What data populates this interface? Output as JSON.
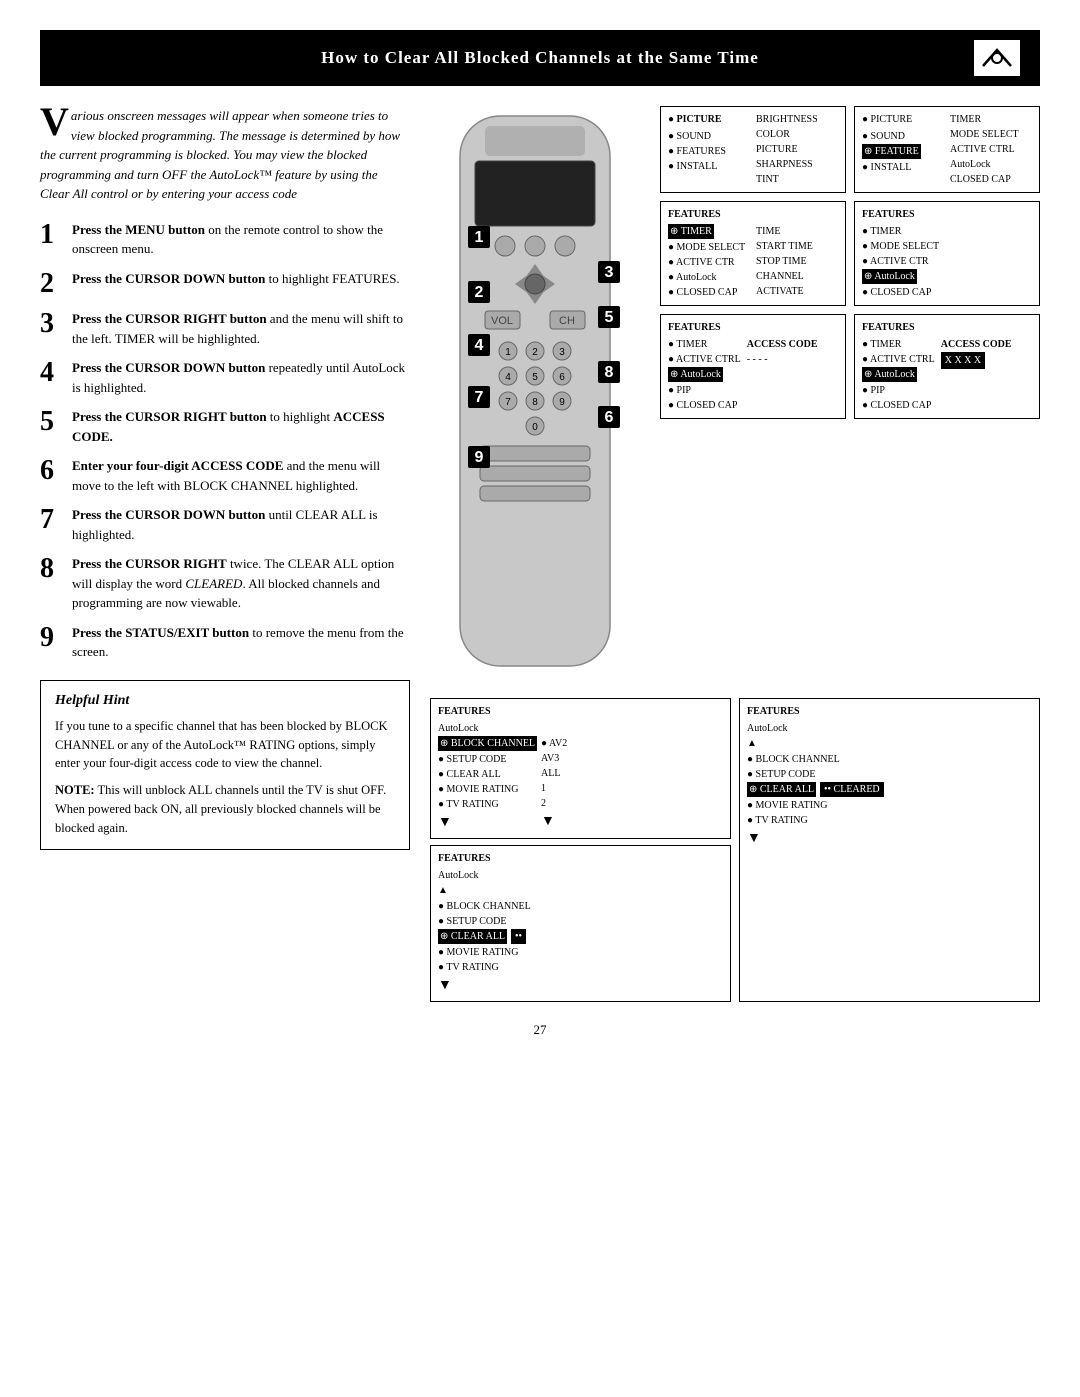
{
  "header": {
    "title": "How to Clear All Blocked Channels at the Same Time"
  },
  "intro": {
    "drop_cap": "V",
    "text": "arious onscreen messages will appear when someone tries to view blocked programming. The message is determined by how the current programming is blocked. You may view the blocked programming and turn OFF the AutoLock™ feature by using the Clear All control or by entering your access code"
  },
  "steps": [
    {
      "number": "1",
      "bold": "Press the MENU button",
      "text": " on the remote control to show the onscreen menu."
    },
    {
      "number": "2",
      "bold": "Press the CURSOR DOWN button",
      "text": " to highlight FEATURES."
    },
    {
      "number": "3",
      "bold": "Press the CURSOR RIGHT button",
      "text": " and the menu will shift to the left. TIMER will be highlighted."
    },
    {
      "number": "4",
      "bold": "Press the CURSOR DOWN button",
      "text": " repeatedly until AutoLock is highlighted."
    },
    {
      "number": "5",
      "bold": "Press the CURSOR RIGHT button",
      "text": " to highlight ACCESS CODE."
    },
    {
      "number": "6",
      "bold": "Enter your four-digit ACCESS CODE",
      "text": " and the menu will move to the left with BLOCK CHANNEL highlighted."
    },
    {
      "number": "7",
      "bold": "Press the CURSOR DOWN button",
      "text": " until CLEAR ALL is highlighted."
    },
    {
      "number": "8",
      "bold": "Press the CURSOR RIGHT",
      "text": " twice. The CLEAR ALL option will display the word CLEARED. All blocked channels and programming are now viewable."
    },
    {
      "number": "9",
      "bold": "Press the STATUS/EXIT button",
      "text": " to remove the menu from the screen."
    }
  ],
  "helpful_hint": {
    "title": "Helpful Hint",
    "paragraphs": [
      "If you tune to a specific channel that has been blocked by BLOCK CHANNEL or any of the AutoLock™ RATING options, simply enter your four-digit access code to view the channel.",
      "NOTE: This will unblock ALL channels until the TV is shut OFF. When powered back ON, all previously blocked channels will be blocked again."
    ]
  },
  "panels": {
    "panel1_title": "PICTURE",
    "panel1_items_left": [
      "SOUND",
      "FEATURES",
      "INSTALL"
    ],
    "panel1_items_right": [
      "BRIGHTNESS",
      "COLOR",
      "PICTURE",
      "SHARPNESS",
      "TINT"
    ],
    "panel2_title": "PICTURE",
    "panel2_items": [
      "SOUND",
      "FEATURE",
      "INSTALL"
    ],
    "panel2_right": [
      "TIMER",
      "MODE SELECT",
      "ACTIVE CTRL",
      "AutoLock",
      "CLOSED CAP"
    ],
    "panel3_title": "FEATURES",
    "panel3_highlighted": "TIMER",
    "panel3_items": [
      "MODE SELECT",
      "ACTIVE CTR",
      "AutoLock",
      "CLOSED CAP"
    ],
    "panel3_right": [
      "TIME",
      "START TIME",
      "STOP TIME",
      "CHANNEL",
      "ACTIVATE"
    ],
    "panel4_title": "FEATURES",
    "panel4_items": [
      "TIMER",
      "MODE SELECT",
      "ACTIVE CTR"
    ],
    "panel4_highlighted": "AutoLock",
    "panel4_items2": [
      "CLOSED CAP"
    ],
    "panel5_title": "FEATURES",
    "panel5_items": [
      "TIMER",
      "ACTIVE CTRL"
    ],
    "panel5_highlighted_autolock": "AutoLock",
    "panel5_items2": [
      "PIP",
      "CLOSED CAP"
    ],
    "panel5_right_label": "ACCESS CODE",
    "panel5_right_val": "- - - -",
    "panel6_title": "FEATURES",
    "panel6_items": [
      "TIMER",
      "ACTIVE CTRL"
    ],
    "panel6_highlighted_autolock": "AutoLock",
    "panel6_items2": [
      "PIP",
      "CLOSED CAP"
    ],
    "panel6_right_label": "ACCESS CODE",
    "panel6_access_box": "X X X X",
    "panel7_title": "FEATURES",
    "panel7_autolock": "AutoLock",
    "panel7_highlighted": "BLOCK CHANNEL",
    "panel7_items": [
      "SETUP CODE",
      "CLEAR ALL",
      "MOVIE RATING",
      "TV RATING"
    ],
    "panel7_right": [
      "AV2",
      "AV3",
      "ALL",
      "1",
      "2"
    ],
    "panel8_title": "FEATURES",
    "panel8_autolock": "AutoLock",
    "panel8_items": [
      "BLOCK CHANNEL",
      "SETUP CODE"
    ],
    "panel8_highlighted": "CLEAR ALL",
    "panel8_items2": [
      "MOVIE RATING",
      "TV RATING"
    ],
    "panel8_right_box": "••",
    "panel9_title": "FEATURES",
    "panel9_autolock": "AutoLock",
    "panel9_items": [
      "BLOCK CHANNEL",
      "SETUP CODE"
    ],
    "panel9_highlighted": "CLEAR ALL",
    "panel9_items2": [
      "MOVIE RATING",
      "TV RATING"
    ],
    "panel9_right_box": "•• CLEARED"
  },
  "page_number": "27"
}
